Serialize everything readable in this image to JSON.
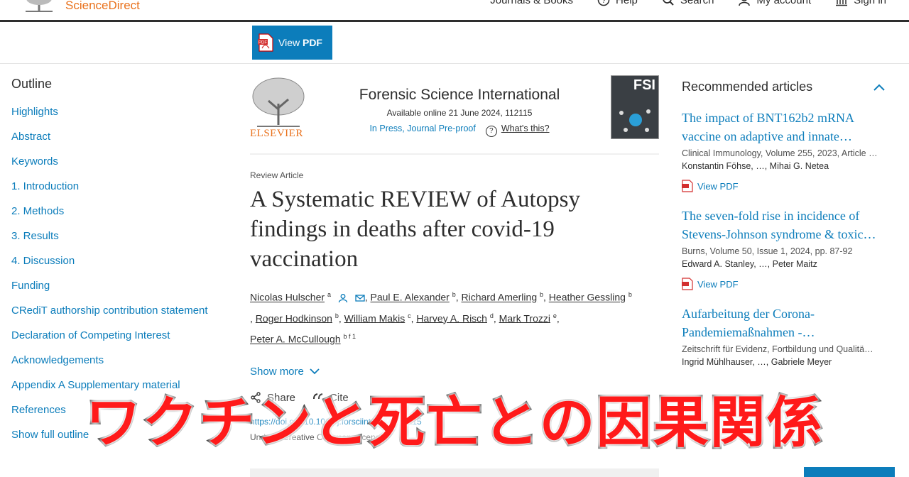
{
  "nav": {
    "brand": "ScienceDirect",
    "journals_books": "Journals & Books",
    "help": "Help",
    "search": "Search",
    "my_account": "My account",
    "sign_in": "Sign in"
  },
  "toolbar": {
    "view": "View",
    "pdf": "PDF"
  },
  "outline": {
    "title": "Outline",
    "items": [
      "Highlights",
      "Abstract",
      "Keywords",
      "1. Introduction",
      "2. Methods",
      "3. Results",
      "4. Discussion",
      "Funding",
      "CRediT authorship contribution statement",
      "Declaration of Competing Interest",
      "Acknowledgements",
      "Appendix A Supplementary material",
      "References",
      "Show full outline"
    ]
  },
  "journal": {
    "publisher": "ELSEVIER",
    "name": "Forensic Science International",
    "available": "Available online 21 June 2024, 112115",
    "in_press": "In Press, Journal Pre-proof",
    "whats_this": "What's this?",
    "cover_label": "FSI"
  },
  "article": {
    "type": "Review Article",
    "title": "A Systematic REVIEW of Autopsy findings in deaths after covid-19 vaccination",
    "authors": [
      {
        "name": "Nicolas Hulscher",
        "sup": "a"
      },
      {
        "name": "Paul E. Alexander",
        "sup": "b"
      },
      {
        "name": "Richard Amerling",
        "sup": "b"
      },
      {
        "name": "Heather Gessling",
        "sup": "b"
      },
      {
        "name": "Roger Hodkinson",
        "sup": "b"
      },
      {
        "name": "William Makis",
        "sup": "c"
      },
      {
        "name": "Harvey A. Risch",
        "sup": "d"
      },
      {
        "name": "Mark Trozzi",
        "sup": "e"
      },
      {
        "name": "Peter A. McCullough",
        "sup": "b f 1"
      }
    ],
    "show_more": "Show more",
    "share": "Share",
    "cite": "Cite",
    "doi": "https://doi.org/10.1016/j.forsciint.2024.112115",
    "order": "Under a Creative Commons license"
  },
  "recommended": {
    "title": "Recommended articles",
    "items": [
      {
        "title": "The impact of BNT162b2 mRNA vaccine on adaptive and innate…",
        "source": "Clinical Immunology, Volume 255, 2023, Article …",
        "authors": "Konstantin Föhse, …, Mihai G. Netea",
        "pdf": "View PDF"
      },
      {
        "title": "The seven-fold rise in incidence of Stevens-Johnson syndrome & toxic…",
        "source": "Burns, Volume 50, Issue 1, 2024, pp. 87-92",
        "authors": "Edward A. Stanley, …, Peter Maitz",
        "pdf": "View PDF"
      },
      {
        "title": "Aufarbeitung der Corona-Pandemiemaßnahmen -…",
        "source": "Zeitschrift für Evidenz, Fortbildung und Qualitä…",
        "authors": "Ingrid Mühlhauser, …, Gabriele Meyer",
        "pdf": ""
      }
    ]
  },
  "caption": "ワクチンと死亡との因果関係",
  "colors": {
    "accent": "#0c7dbb",
    "brand": "#e9711c",
    "caption": "#ff1a1a"
  }
}
